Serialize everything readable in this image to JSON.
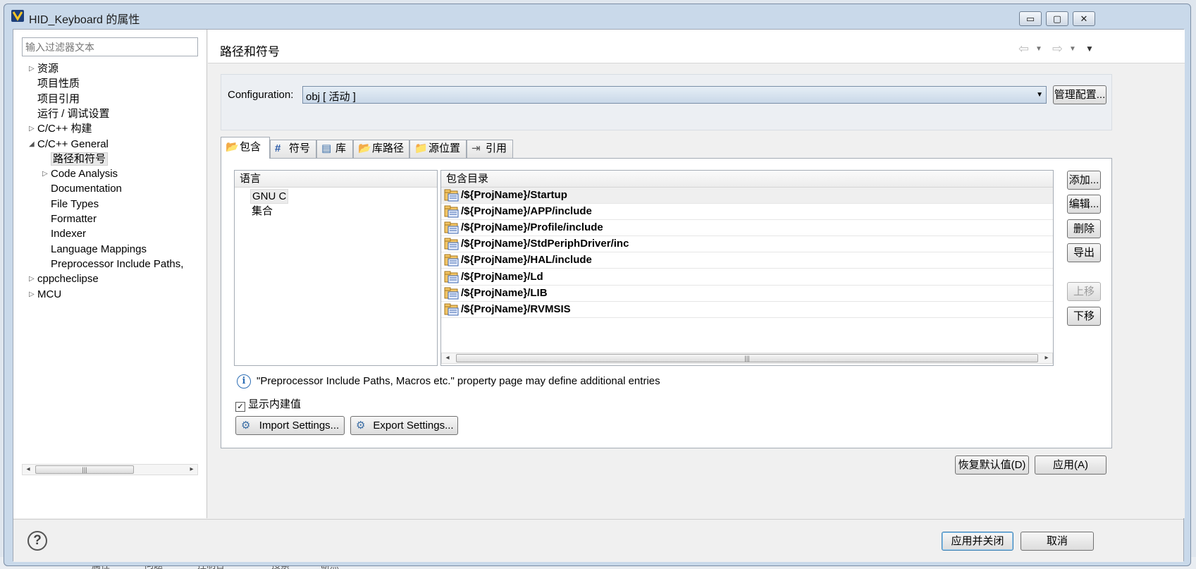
{
  "window": {
    "title": "HID_Keyboard 的属性",
    "minimize_glyph": "▭",
    "maximize_glyph": "▢",
    "close_glyph": "✕"
  },
  "filter": {
    "placeholder": "输入过滤器文本"
  },
  "tree": {
    "items": [
      {
        "label": "资源",
        "expander": "▷"
      },
      {
        "label": "项目性质",
        "expander": ""
      },
      {
        "label": "项目引用",
        "expander": ""
      },
      {
        "label": "运行 / 调试设置",
        "expander": ""
      },
      {
        "label": "C/C++ 构建",
        "expander": "▷"
      },
      {
        "label": "C/C++ General",
        "expander": "◢"
      },
      {
        "label": "路径和符号",
        "expander": "",
        "selected": true
      },
      {
        "label": "Code Analysis",
        "expander": "▷"
      },
      {
        "label": "Documentation",
        "expander": ""
      },
      {
        "label": "File Types",
        "expander": ""
      },
      {
        "label": "Formatter",
        "expander": ""
      },
      {
        "label": "Indexer",
        "expander": ""
      },
      {
        "label": "Language Mappings",
        "expander": ""
      },
      {
        "label": "Preprocessor Include Paths,",
        "expander": ""
      },
      {
        "label": "cppcheclipse",
        "expander": "▷"
      },
      {
        "label": "MCU",
        "expander": "▷"
      }
    ]
  },
  "page": {
    "title": "路径和符号",
    "config_label": "Configuration:",
    "config_value": "obj  [ 活动 ]",
    "manage_button": "管理配置...",
    "tabs": [
      {
        "label": "包含",
        "icon": "folder-include-icon"
      },
      {
        "label": "符号",
        "icon": "hash-icon"
      },
      {
        "label": "库",
        "icon": "library-icon"
      },
      {
        "label": "库路径",
        "icon": "library-path-icon"
      },
      {
        "label": "源位置",
        "icon": "source-folder-icon"
      },
      {
        "label": "引用",
        "icon": "reference-icon"
      }
    ],
    "languages_header": "语言",
    "languages": [
      "GNU C",
      "集合"
    ],
    "includes_header": "包含目录",
    "includes": [
      "/${ProjName}/Startup",
      "/${ProjName}/APP/include",
      "/${ProjName}/Profile/include",
      "/${ProjName}/StdPeriphDriver/inc",
      "/${ProjName}/HAL/include",
      "/${ProjName}/Ld",
      "/${ProjName}/LIB",
      "/${ProjName}/RVMSIS"
    ],
    "side_buttons": {
      "add": "添加...",
      "edit": "编辑...",
      "delete": "删除",
      "export": "导出",
      "up": "上移",
      "down": "下移"
    },
    "info_text": "\"Preprocessor Include Paths, Macros etc.\" property page may define additional entries",
    "show_builtin": "显示内建值",
    "show_builtin_checked": true,
    "import_button": "Import Settings...",
    "export_button": "Export Settings...",
    "restore_defaults": "恢复默认值(D)",
    "apply": "应用(A)"
  },
  "bottom": {
    "apply_close": "应用并关闭",
    "cancel": "取消"
  },
  "background_text": [
    "属性",
    "问题",
    "控制台",
    "搜索",
    "断点"
  ],
  "colors": {
    "accent": "#3c7fb1",
    "titlebar": "#c9d9ea",
    "selection_row": "#e8e8e8"
  }
}
